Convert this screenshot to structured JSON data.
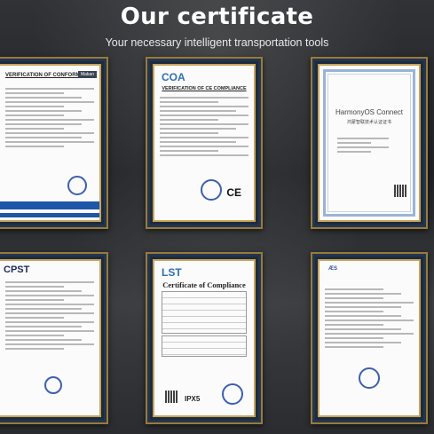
{
  "banner": {
    "title": "Our certificate",
    "subtitle": "Your necessary intelligent transportation tools"
  },
  "certificates": [
    {
      "heading": "VERIFICATION OF CONFORMITY",
      "tag": "Makan"
    },
    {
      "logo": "COA",
      "heading": "VERIFICATION OF CE COMPLIANCE",
      "mark": "CE"
    },
    {
      "title": "HarmonyOS Connect",
      "subtitle": "鸿蒙智联技术认证证书"
    },
    {
      "logo": "CPST"
    },
    {
      "logo": "LST",
      "title": "Certificate of Compliance",
      "rating": "IPX5"
    },
    {
      "logo": "ÆS"
    }
  ]
}
